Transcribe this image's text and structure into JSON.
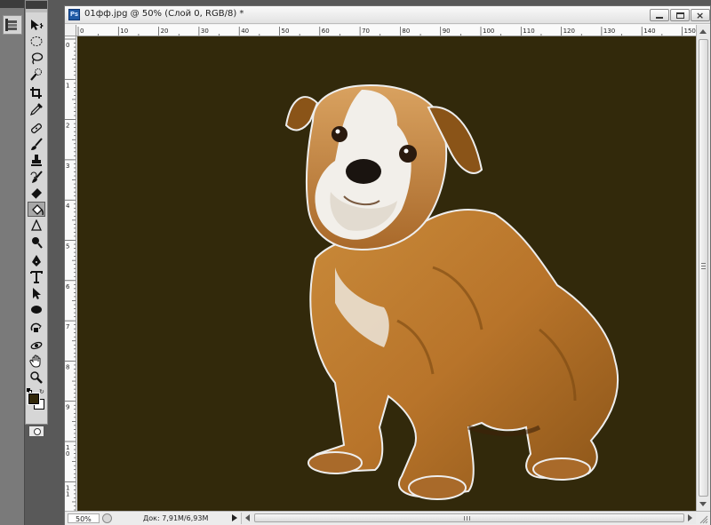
{
  "document": {
    "title": "01фф.jpg @ 50% (Слой 0, RGB/8) *",
    "app_icon_label": "Ps",
    "canvas_background": "#32290b"
  },
  "ruler": {
    "top_labels": [
      "0",
      "10",
      "20",
      "30",
      "40",
      "50",
      "60",
      "70",
      "80",
      "90",
      "100",
      "110",
      "120",
      "130",
      "140",
      "150"
    ],
    "left_labels": [
      "0",
      "1",
      "2",
      "3",
      "4",
      "5",
      "6",
      "7",
      "8",
      "9",
      "10",
      "11",
      "12"
    ]
  },
  "status": {
    "zoom": "50%",
    "doc_size": "Док: 7,91M/6,93M"
  },
  "colors": {
    "foreground": "#32280a",
    "background": "#ffffff"
  },
  "tools": [
    "move-tool-icon",
    "marquee-tool-icon",
    "lasso-tool-icon",
    "quick-selection-tool-icon",
    "crop-tool-icon",
    "eyedropper-tool-icon",
    "spot-healing-tool-icon",
    "brush-tool-icon",
    "clone-stamp-tool-icon",
    "history-brush-tool-icon",
    "eraser-tool-icon",
    "paint-bucket-tool-icon",
    "blur-tool-icon",
    "dodge-tool-icon",
    "pen-tool-icon",
    "type-tool-icon",
    "path-selection-tool-icon",
    "ellipse-tool-icon",
    "3d-rotate-tool-icon",
    "3d-orbit-tool-icon",
    "hand-tool-icon",
    "zoom-tool-icon"
  ]
}
